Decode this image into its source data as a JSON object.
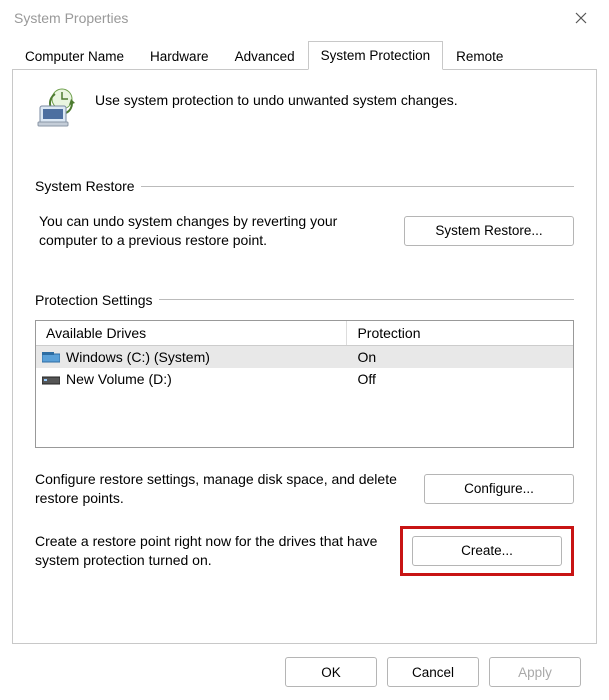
{
  "window": {
    "title": "System Properties"
  },
  "tabs": {
    "t0": "Computer Name",
    "t1": "Hardware",
    "t2": "Advanced",
    "t3": "System Protection",
    "t4": "Remote"
  },
  "intro": {
    "text": "Use system protection to undo unwanted system changes."
  },
  "group_restore": {
    "title": "System Restore",
    "desc": "You can undo system changes by reverting your computer to a previous restore point.",
    "button": "System Restore..."
  },
  "group_settings": {
    "title": "Protection Settings",
    "col_drives": "Available Drives",
    "col_protection": "Protection",
    "rows": [
      {
        "name": "Windows (C:) (System)",
        "protection": "On"
      },
      {
        "name": "New Volume (D:)",
        "protection": "Off"
      }
    ],
    "configure_desc": "Configure restore settings, manage disk space, and delete restore points.",
    "configure_btn": "Configure...",
    "create_desc": "Create a restore point right now for the drives that have system protection turned on.",
    "create_btn": "Create..."
  },
  "footer": {
    "ok": "OK",
    "cancel": "Cancel",
    "apply": "Apply"
  }
}
